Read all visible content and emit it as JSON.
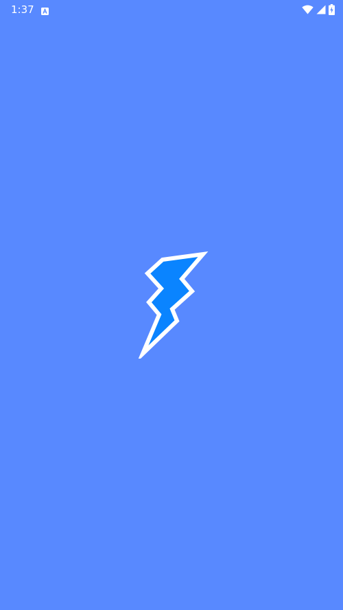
{
  "status_bar": {
    "time": "1:37",
    "notification_icon": "accessibility-a-icon",
    "wifi_icon": "wifi-icon",
    "signal_icon": "cell-signal-icon",
    "battery_icon": "battery-charging-icon"
  },
  "splash": {
    "logo_icon": "lightning-bolt-icon"
  },
  "colors": {
    "background": "#5889FF",
    "bolt_fill": "#0A84FF",
    "bolt_outline": "#FFFFFF"
  }
}
